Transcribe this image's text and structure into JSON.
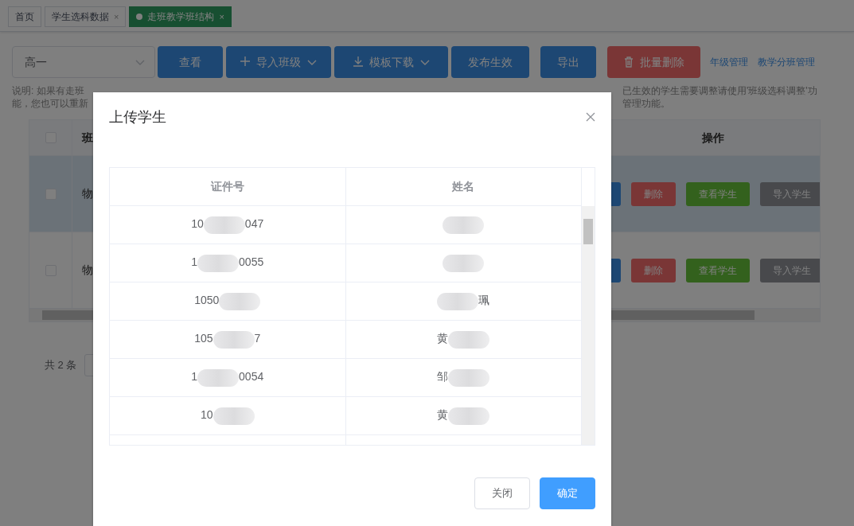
{
  "tabs": [
    {
      "label": "首页",
      "selected": false,
      "kind": "home"
    },
    {
      "label": "学生选科数据",
      "selected": false,
      "kind": "page"
    },
    {
      "label": "走班教学班结构",
      "selected": true,
      "kind": "page"
    }
  ],
  "close_glyph": "×",
  "toolbar": {
    "grade_select": {
      "value": "高一"
    },
    "buttons": [
      {
        "label": "查看",
        "kind": "view"
      },
      {
        "label": "导入班级",
        "kind": "import"
      },
      {
        "label": "模板下载",
        "kind": "download"
      },
      {
        "label": "发布生效",
        "kind": "publish"
      },
      {
        "label": "导出",
        "kind": "export"
      },
      {
        "label": "批量删除",
        "kind": "delete"
      }
    ],
    "links": [
      "年级管理",
      "教学分班管理"
    ]
  },
  "description": {
    "left_lines": [
      "说明: 如果有走班",
      "能，您也可以重新"
    ],
    "right_lines": [
      "已生效的学生需要调整请使用'班级选科调整'功",
      "管理功能。"
    ]
  },
  "table": {
    "header_checked": false,
    "columns": [
      "班",
      "操作"
    ],
    "rows": [
      {
        "checked": false,
        "highlighted": true,
        "column_2": "物",
        "actions": [
          {
            "label": "删除",
            "kind": "danger"
          },
          {
            "label": "查看学生",
            "kind": "success"
          },
          {
            "label": "导入学生",
            "kind": "info"
          }
        ]
      },
      {
        "checked": false,
        "highlighted": false,
        "column_2": "物",
        "actions": [
          {
            "label": "删除",
            "kind": "danger"
          },
          {
            "label": "查看学生",
            "kind": "success"
          },
          {
            "label": "导入学生",
            "kind": "info"
          }
        ]
      }
    ]
  },
  "pagination": {
    "total": "共 2 条"
  },
  "modal": {
    "title": "上传学生",
    "columns": [
      "证件号",
      "姓名"
    ],
    "rows": [
      {
        "id": {
          "before": "10",
          "after": "047"
        },
        "name": {}
      },
      {
        "id": {
          "before": "1",
          "after": "0055"
        },
        "name": {}
      },
      {
        "id": {
          "before": "1050"
        },
        "name": {
          "after": "珮"
        }
      },
      {
        "id": {
          "before": "105",
          "after": "7"
        },
        "name": {
          "before": "黄"
        }
      },
      {
        "id": {
          "before": "1",
          "after": "0054"
        },
        "name": {
          "before": "邹"
        }
      },
      {
        "id": {
          "before": "10"
        },
        "name": {
          "before": "黄"
        }
      }
    ],
    "buttons": [
      {
        "label": "关闭",
        "kind": "default"
      },
      {
        "label": "确定",
        "kind": "primary"
      }
    ]
  }
}
